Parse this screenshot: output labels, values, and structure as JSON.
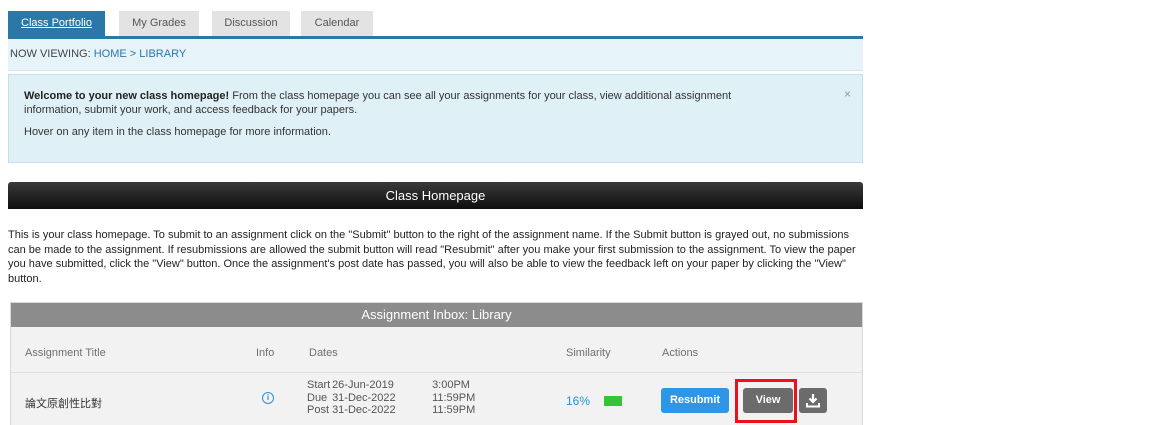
{
  "tabs": [
    {
      "label": "Class Portfolio",
      "active": true
    },
    {
      "label": "My Grades"
    },
    {
      "label": "Discussion"
    },
    {
      "label": "Calendar"
    }
  ],
  "breadcrumb": {
    "prefix": "NOW VIEWING:",
    "home": "HOME",
    "sep": ">",
    "current": "LIBRARY"
  },
  "welcome": {
    "bold": "Welcome to your new class homepage!",
    "text": " From the class homepage you can see all your assignments for your class, view additional assignment information, submit your work, and access feedback for your papers.",
    "hover_text": "Hover on any item in the class homepage for more information.",
    "close": "×"
  },
  "homepage_title": "Class Homepage",
  "description": "This is your class homepage. To submit to an assignment click on the \"Submit\" button to the right of the assignment name. If the Submit button is grayed out, no submissions can be made to the assignment. If resubmissions are allowed the submit button will read \"Resubmit\" after you make your first submission to the assignment. To view the paper you have submitted, click the \"View\" button. Once the assignment's post date has passed, you will also be able to view the feedback left on your paper by clicking the \"View\" button.",
  "inbox": {
    "title": "Assignment Inbox: Library",
    "columns": {
      "title": "Assignment Title",
      "info": "Info",
      "dates": "Dates",
      "similarity": "Similarity",
      "actions": "Actions"
    },
    "row": {
      "title": "論文原創性比對",
      "info_icon": "i",
      "start_label": "Start",
      "start_date": "26-Jun-2019",
      "start_time": "3:00PM",
      "due_label": "Due",
      "due_date": "31-Dec-2022",
      "due_time": "11:59PM",
      "post_label": "Post",
      "post_date": "31-Dec-2022",
      "post_time": "11:59PM",
      "similarity": "16%",
      "resubmit": "Resubmit",
      "view": "View"
    }
  },
  "colors": {
    "accent": "#2a78a8",
    "resubmit": "#2e96e6",
    "similarity_bar": "#35c435",
    "highlight": "#e8121c"
  },
  "icons": {
    "info": "info-circle-icon",
    "download": "download-icon",
    "close": "close-icon"
  }
}
